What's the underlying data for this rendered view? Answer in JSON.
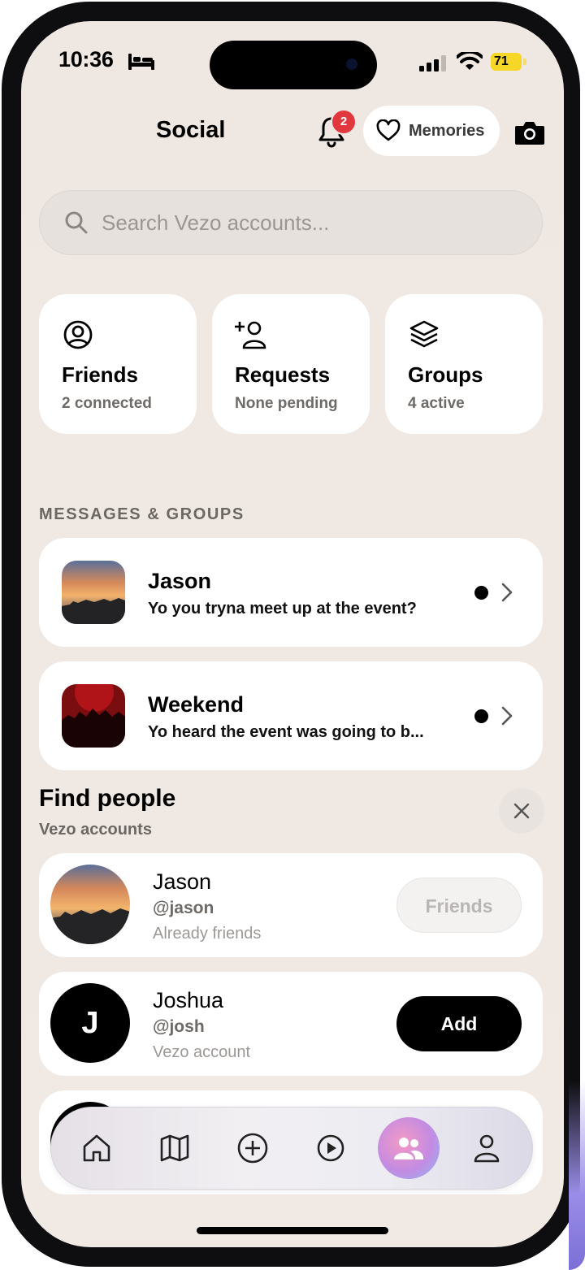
{
  "status_bar": {
    "time": "10:36",
    "battery": "71"
  },
  "header": {
    "title": "Social",
    "notification_count": "2",
    "memories_label": "Memories"
  },
  "search": {
    "placeholder": "Search Vezo accounts..."
  },
  "stats": [
    {
      "label": "Friends",
      "sub": "2 connected",
      "icon": "person-circle-icon"
    },
    {
      "label": "Requests",
      "sub": "None pending",
      "icon": "add-person-icon"
    },
    {
      "label": "Groups",
      "sub": "4 active",
      "icon": "layers-icon"
    }
  ],
  "messages": {
    "section_label": "MESSAGES & GROUPS",
    "items": [
      {
        "name": "Jason",
        "preview": "Yo you tryna meet up at the event?"
      },
      {
        "name": "Weekend",
        "preview": "Yo heard the event was going to b..."
      }
    ]
  },
  "find_people": {
    "title": "Find people",
    "subtitle": "Vezo accounts",
    "people": [
      {
        "name": "Jason",
        "handle": "@jason",
        "note": "Already friends",
        "action": "Friends"
      },
      {
        "name": "Joshua",
        "handle": "@josh",
        "note": "Vezo account",
        "action": "Add",
        "initial": "J"
      }
    ]
  },
  "nav": {
    "items": [
      "home-icon",
      "map-icon",
      "plus-circle-icon",
      "play-circle-icon",
      "people-icon",
      "profile-icon"
    ],
    "active": "people-icon"
  },
  "colors": {
    "badge": "#e0383e",
    "background": "#efe7e1",
    "card": "#ffffff"
  }
}
